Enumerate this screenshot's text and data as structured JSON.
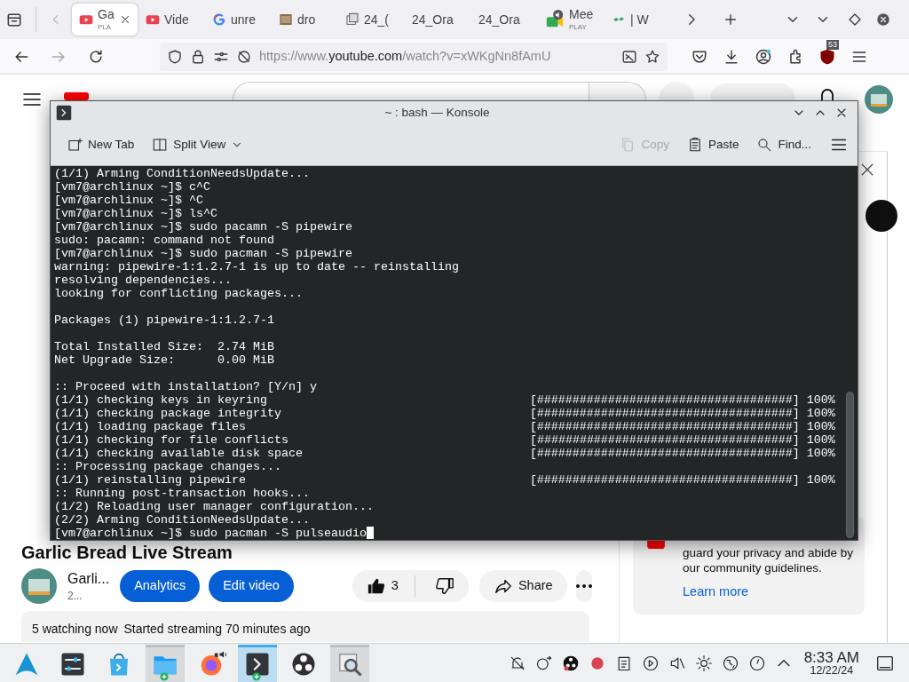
{
  "browser": {
    "tabs": [
      {
        "label": "Ga",
        "sublabel": "PLA",
        "kind": "youtube",
        "selected": true
      },
      {
        "label": "Vide",
        "kind": "youtube",
        "selected": false
      },
      {
        "label": "unre",
        "kind": "google",
        "selected": false
      },
      {
        "label": "dro",
        "kind": "image",
        "selected": false
      },
      {
        "label": "24_(",
        "kind": "document",
        "selected": false
      },
      {
        "label": "24_Ora",
        "kind": "plain",
        "selected": false
      },
      {
        "label": "24_Ora",
        "kind": "plain",
        "selected": false
      },
      {
        "label": "Mee",
        "sublabel": "PLAY",
        "kind": "meet",
        "selected": false
      },
      {
        "label": "| W",
        "kind": "leaf",
        "selected": false
      }
    ],
    "address": "https://www.youtube.com/watch?v=xWKgNn8fAmU",
    "extension_badge": "53"
  },
  "konsole": {
    "title": "~ : bash — Konsole",
    "actions": [
      {
        "label": "New Tab",
        "kind": "newtab",
        "disabled": false
      },
      {
        "label": "Split View",
        "kind": "split",
        "disabled": false
      },
      {
        "label": "Copy",
        "kind": "copy",
        "disabled": true
      },
      {
        "label": "Paste",
        "kind": "paste",
        "disabled": false
      },
      {
        "label": "Find...",
        "kind": "find",
        "disabled": false
      }
    ],
    "lines": [
      {
        "kind": "text",
        "text": "(1/1) Arming ConditionNeedsUpdate..."
      },
      {
        "kind": "text",
        "text": "[vm7@archlinux ~]$ c^C"
      },
      {
        "kind": "text",
        "text": "[vm7@archlinux ~]$ ^C"
      },
      {
        "kind": "text",
        "text": "[vm7@archlinux ~]$ ls^C"
      },
      {
        "kind": "text",
        "text": "[vm7@archlinux ~]$ sudo pacamn -S pipewire"
      },
      {
        "kind": "text",
        "text": "sudo: pacamn: command not found"
      },
      {
        "kind": "text",
        "text": "[vm7@archlinux ~]$ sudo pacman -S pipewire"
      },
      {
        "kind": "text",
        "text": "warning: pipewire-1:1.2.7-1 is up to date -- reinstalling"
      },
      {
        "kind": "text",
        "text": "resolving dependencies..."
      },
      {
        "kind": "text",
        "text": "looking for conflicting packages..."
      },
      {
        "kind": "blank"
      },
      {
        "kind": "text",
        "text": "Packages (1) pipewire-1:1.2.7-1"
      },
      {
        "kind": "blank"
      },
      {
        "kind": "text",
        "text": "Total Installed Size:  2.74 MiB"
      },
      {
        "kind": "text",
        "text": "Net Upgrade Size:      0.00 MiB"
      },
      {
        "kind": "blank"
      },
      {
        "kind": "text",
        "text": ":: Proceed with installation? [Y/n] y"
      },
      {
        "kind": "progress",
        "text": "(1/1) checking keys in keyring",
        "progress": "[####################################] 100%"
      },
      {
        "kind": "progress",
        "text": "(1/1) checking package integrity",
        "progress": "[####################################] 100%"
      },
      {
        "kind": "progress",
        "text": "(1/1) loading package files",
        "progress": "[####################################] 100%"
      },
      {
        "kind": "progress",
        "text": "(1/1) checking for file conflicts",
        "progress": "[####################################] 100%"
      },
      {
        "kind": "progress",
        "text": "(1/1) checking available disk space",
        "progress": "[####################################] 100%"
      },
      {
        "kind": "text",
        "text": ":: Processing package changes..."
      },
      {
        "kind": "progress",
        "text": "(1/1) reinstalling pipewire",
        "progress": "[####################################] 100%"
      },
      {
        "kind": "text",
        "text": ":: Running post-transaction hooks..."
      },
      {
        "kind": "text",
        "text": "(1/2) Reloading user manager configuration..."
      },
      {
        "kind": "text",
        "text": "(2/2) Arming ConditionNeedsUpdate..."
      },
      {
        "kind": "text",
        "text": "[vm7@archlinux ~]$ sudo pacman -S pulseaudio"
      }
    ],
    "cursor_visible": true
  },
  "video": {
    "title": "Garlic Bread Live Stream",
    "channel": "Garli...",
    "subscribers": "2...",
    "buttons": [
      "Analytics",
      "Edit video"
    ],
    "likes": "3",
    "share": "Share",
    "watching": "5 watching now",
    "started": "Started streaming 70 minutes ago"
  },
  "chat": {
    "message": "guard your privacy and abide by our community guidelines.",
    "link": "Learn more"
  },
  "taskbar": {
    "apps": [
      {
        "kind": "launcher",
        "open": false,
        "selected": false,
        "plus_badge": false
      },
      {
        "kind": "mixer",
        "open": false,
        "selected": false,
        "plus_badge": false
      },
      {
        "kind": "store",
        "open": false,
        "selected": false,
        "plus_badge": false
      },
      {
        "kind": "files",
        "open": true,
        "selected": false,
        "plus_badge": true
      },
      {
        "kind": "firefox",
        "open": false,
        "selected": false,
        "plus_badge": false
      },
      {
        "kind": "terminal",
        "open": true,
        "selected": true,
        "plus_badge": true
      },
      {
        "kind": "obs",
        "open": false,
        "selected": false,
        "plus_badge": false
      },
      {
        "kind": "viewer",
        "open": true,
        "selected": false,
        "plus_badge": false
      }
    ],
    "time": "8:33 AM",
    "date": "12/22/24"
  }
}
